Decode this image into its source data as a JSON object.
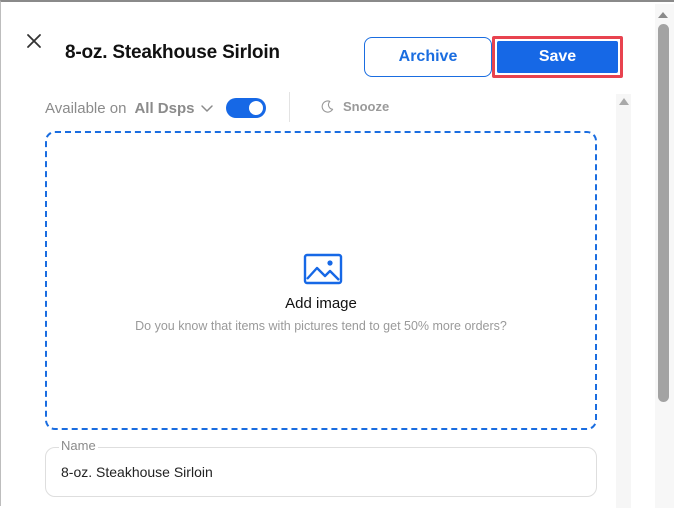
{
  "header": {
    "title": "8-oz. Steakhouse Sirloin",
    "archive_label": "Archive",
    "save_label": "Save"
  },
  "availability": {
    "label": "Available on",
    "dsps_value": "All Dsps",
    "enabled": true,
    "snooze_label": "Snooze"
  },
  "image_upload": {
    "title": "Add image",
    "hint": "Do you know that items with pictures tend to get 50% more orders?"
  },
  "form": {
    "name_label": "Name",
    "name_value": "8-oz. Steakhouse Sirloin"
  },
  "colors": {
    "accent": "#1668e6",
    "highlight": "#e8434f"
  },
  "icons": [
    "close-icon",
    "chevron-down-icon",
    "moon-icon",
    "image-icon"
  ]
}
